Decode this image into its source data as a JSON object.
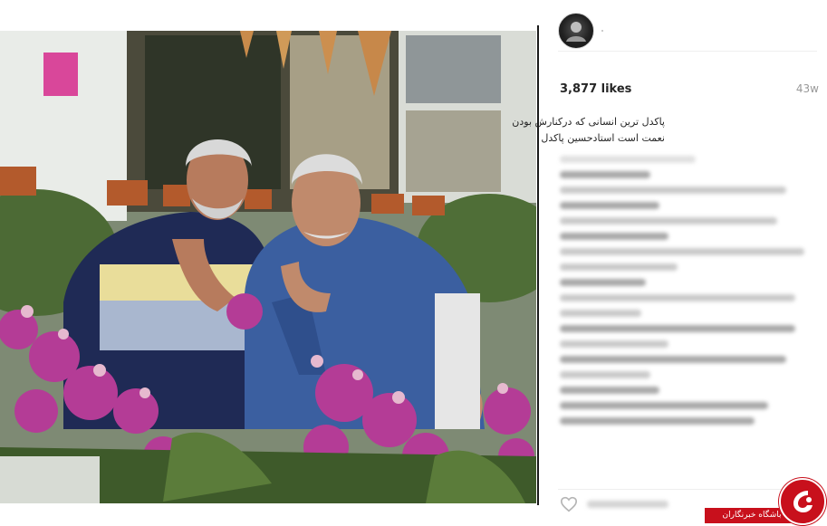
{
  "post": {
    "likes": "3,877 likes",
    "age": "43w",
    "caption_line1": "پاکدل ترین انسانی که درکنارش بودن",
    "caption_line2": "نعمت است استادحسین پاکدل"
  },
  "watermark": {
    "label": "باشگاه خبرنگاران"
  },
  "icons": {
    "avatar": "profile-avatar",
    "like": "heart-icon",
    "logo": "news-agency-logo"
  },
  "colors": {
    "text": "#262626",
    "muted": "#999999",
    "divider": "#1a1a1a",
    "brand_red": "#c8101c"
  }
}
